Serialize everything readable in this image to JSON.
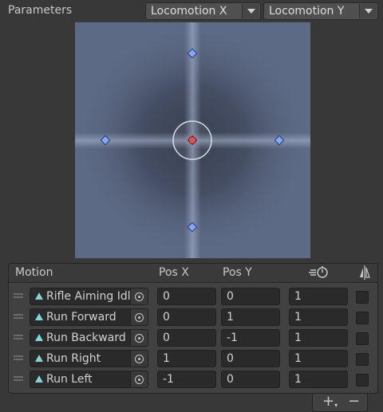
{
  "parameters": {
    "label": "Parameters",
    "param_x": "Locomotion X",
    "param_y": "Locomotion Y"
  },
  "blend_space": {
    "range_x": [
      -1,
      1
    ],
    "range_y": [
      -1,
      1
    ],
    "points": [
      {
        "x": 0,
        "y": 0
      },
      {
        "x": 0,
        "y": 1
      },
      {
        "x": 0,
        "y": -1
      },
      {
        "x": 1,
        "y": 0
      },
      {
        "x": -1,
        "y": 0
      }
    ],
    "preview": {
      "x": 0,
      "y": 0
    },
    "colors": {
      "background": "#5d6a85",
      "point": "#7fa8ff",
      "preview": "#e05050"
    }
  },
  "table": {
    "headers": {
      "motion": "Motion",
      "pos_x": "Pos X",
      "pos_y": "Pos Y",
      "speed_icon": "speed-clock-icon",
      "mirror_icon": "mirror-icon"
    },
    "rows": [
      {
        "motion": "Rifle Aiming Idle",
        "pos_x": "0",
        "pos_y": "0",
        "speed": "1",
        "mirror": false
      },
      {
        "motion": "Run Forward",
        "pos_x": "0",
        "pos_y": "1",
        "speed": "1",
        "mirror": false
      },
      {
        "motion": "Run Backward",
        "pos_x": "0",
        "pos_y": "-1",
        "speed": "1",
        "mirror": false
      },
      {
        "motion": "Run Right",
        "pos_x": "1",
        "pos_y": "0",
        "speed": "1",
        "mirror": false
      },
      {
        "motion": "Run Left",
        "pos_x": "-1",
        "pos_y": "0",
        "speed": "1",
        "mirror": false
      }
    ]
  },
  "footer": {
    "add_label": "+",
    "add_dropdown_icon": "chevron-down-icon",
    "remove_label": "−"
  }
}
